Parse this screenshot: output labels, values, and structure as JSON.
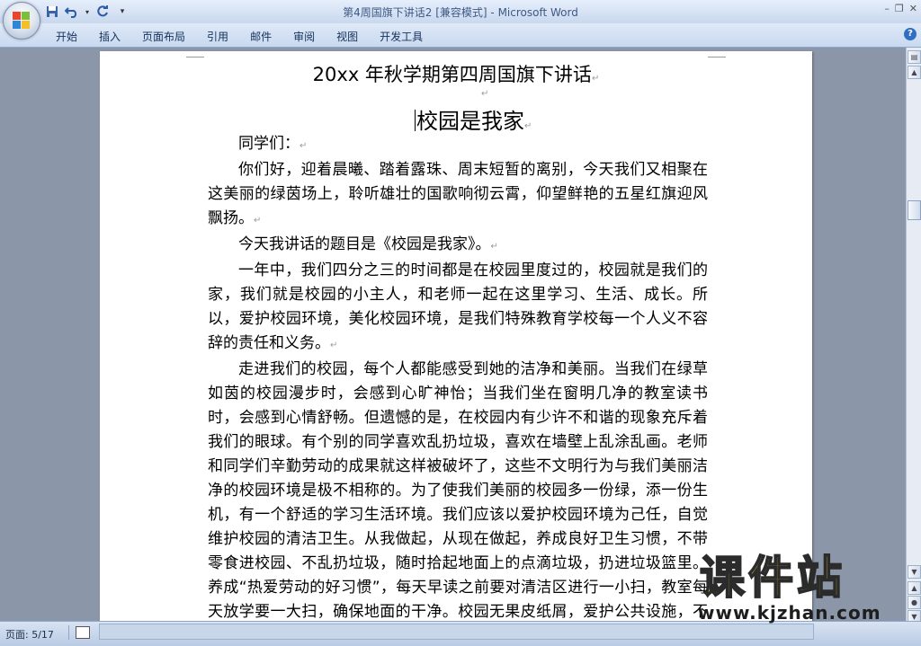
{
  "window": {
    "title": "第4周国旗下讲话2 [兼容模式] - Microsoft Word"
  },
  "quick_access": {
    "icons": [
      "save-icon",
      "undo-icon",
      "redo-icon",
      "customize-icon"
    ]
  },
  "ribbon": {
    "tabs": [
      "开始",
      "插入",
      "页面布局",
      "引用",
      "邮件",
      "审阅",
      "视图",
      "开发工具"
    ]
  },
  "document": {
    "title": "20xx 年秋学期第四周国旗下讲话",
    "subtitle": "校园是我家",
    "paragraph_mark": "↵",
    "paragraphs": [
      "同学们：",
      "你们好，迎着晨曦、踏着露珠、周末短暂的离别，今天我们又相聚在这美丽的绿茵场上，聆听雄壮的国歌响彻云霄，仰望鲜艳的五星红旗迎风飘扬。",
      "今天我讲话的题目是《校园是我家》。",
      "一年中，我们四分之三的时间都是在校园里度过的，校园就是我们的家，我们就是校园的小主人，和老师一起在这里学习、生活、成长。所以，爱护校园环境，美化校园环境，是我们特殊教育学校每一个人义不容辞的责任和义务。",
      "走进我们的校园，每个人都能感受到她的洁净和美丽。当我们在绿草如茵的校园漫步时，会感到心旷神怡；当我们坐在窗明几净的教室读书时，会感到心情舒畅。但遗憾的是，在校园内有少许不和谐的现象充斥着我们的眼球。有个别的同学喜欢乱扔垃圾，喜欢在墙壁上乱涂乱画。老师和同学们辛勤劳动的成果就这样被破坏了，这些不文明行为与我们美丽洁净的校园环境是极不相称的。为了使我们美丽的校园多一份绿，添一份生机，有一个舒适的学习生活环境。我们应该以爱护校园环境为己任，自觉维护校园的清洁卫生。从我做起，从现在做起，养成良好卫生习惯，不带零食进校园、不乱扔垃圾，随时拾起地面上的点滴垃圾，扔进垃圾篮里。养成“热爱劳动的好习惯”，每天早读之前要对清洁区进行一小扫，教室每天放学要一大扫，确保地面的干净。校园无果皮纸屑，爱护公共设施，不乱涂乱画，不践踏草"
    ]
  },
  "status": {
    "page_label": "页面: 5/17"
  },
  "watermark": {
    "big": "课件站",
    "url": "www.kjzhan.com"
  },
  "colors": {
    "title_text": "#3d5a85",
    "workspace": "#8b97a8",
    "watermark_yellow": "#f7e42a"
  }
}
